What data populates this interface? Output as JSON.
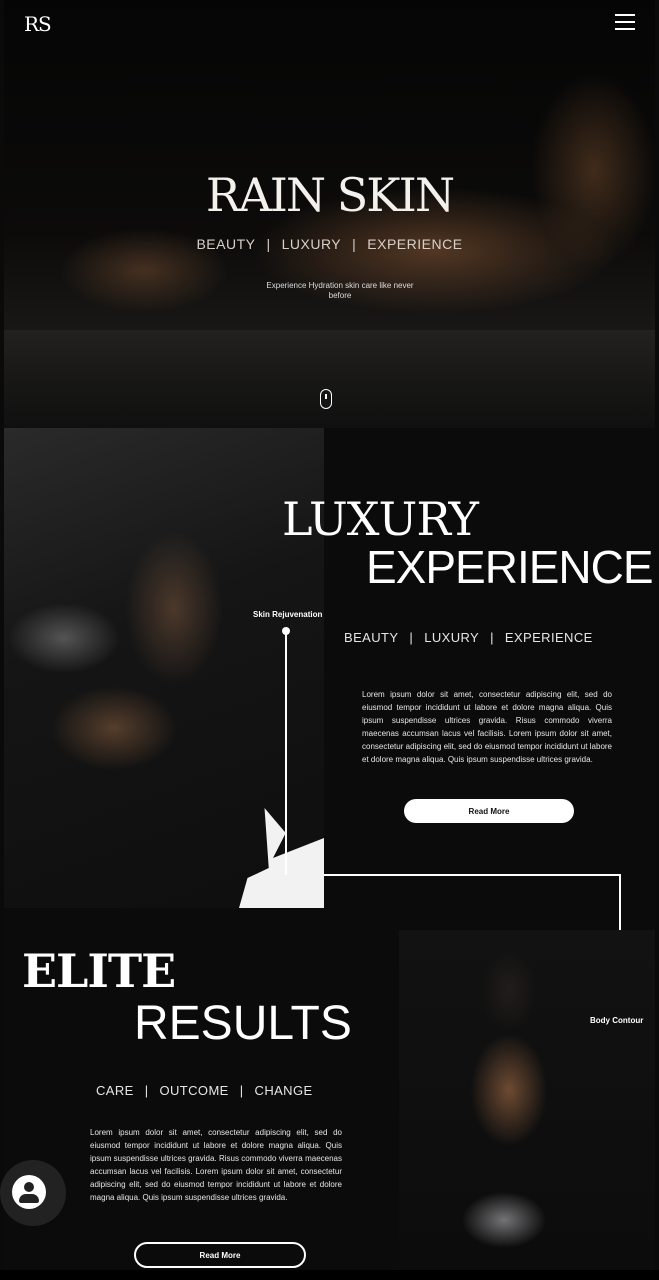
{
  "header": {
    "logo": "RS"
  },
  "hero": {
    "title": "RAIN SKIN",
    "tags": [
      "BEAUTY",
      "LUXURY",
      "EXPERIENCE"
    ],
    "separator": "|",
    "subtitle": "Experience Hydration skin care like never before"
  },
  "luxury": {
    "title_line1": "LUXURY",
    "title_line2": "EXPERIENCE",
    "tags": [
      "BEAUTY",
      "LUXURY",
      "EXPERIENCE"
    ],
    "body": "Lorem ipsum dolor sit amet, consectetur adipiscing elit, sed do eiusmod tempor incididunt ut labore et dolore magna aliqua. Quis ipsum suspendisse ultrices gravida. Risus commodo viverra maecenas accumsan lacus vel facilisis. Lorem ipsum dolor sit amet, consectetur adipiscing elit, sed do eiusmod tempor incididunt ut labore et dolore magna aliqua. Quis ipsum suspendisse ultrices gravida.",
    "button_label": "Read More",
    "callout_label": "Skin Rejuvenation"
  },
  "elite": {
    "title_line1": "ELITE",
    "title_line2": "RESULTS",
    "tags": [
      "CARE",
      "OUTCOME",
      "CHANGE"
    ],
    "body": "Lorem ipsum dolor sit amet, consectetur adipiscing elit, sed do eiusmod tempor incididunt ut labore et dolore magna aliqua. Quis ipsum suspendisse ultrices gravida. Risus commodo viverra maecenas accumsan lacus vel facilisis. Lorem ipsum dolor sit amet, consectetur adipiscing elit, sed do eiusmod tempor incididunt ut labore et dolore magna aliqua. Quis ipsum suspendisse ultrices gravida.",
    "button_label": "Read More",
    "callout_label": "Body Contour"
  },
  "icons": {
    "menu": "hamburger-menu-icon",
    "scroll": "mouse-scroll-icon",
    "account": "user-avatar-icon"
  }
}
